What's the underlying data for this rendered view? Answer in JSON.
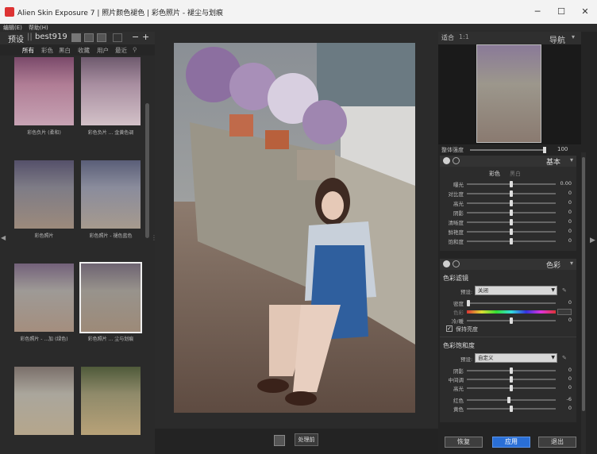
{
  "window": {
    "title": "Alien Skin Exposure 7 | 照片颜色褪色 | 彩色照片 - 褪尘与划痕",
    "minimize": "─",
    "maximize": "☐",
    "close": "✕"
  },
  "menu": [
    "编辑(E)",
    "帮助(H)"
  ],
  "presets": {
    "label": "预设",
    "separator": "||",
    "user": "best919",
    "plus": "+",
    "minus": "−",
    "categories": [
      "所有",
      "彩色",
      "黑白",
      "收藏",
      "用户",
      "最近"
    ],
    "thumbnails": [
      {
        "caption": "彩色负片 (柔和)"
      },
      {
        "caption": "彩色负片 ... 金黄色调"
      },
      {
        "caption": "彩色照片"
      },
      {
        "caption": "彩色照片 - 褪色蓝色"
      },
      {
        "caption": "彩色照片 - ...加 (绿色)"
      },
      {
        "caption": "彩色照片 ... 尘与划痕"
      },
      {
        "caption": ""
      },
      {
        "caption": ""
      }
    ]
  },
  "center": {
    "before_label": "处理前"
  },
  "navigator": {
    "fit_label": "适合",
    "ratio_label": "1:1",
    "title": "导航"
  },
  "overall_strength": {
    "label": "整体强度",
    "value": "100"
  },
  "basic": {
    "title": "基本",
    "tabs": [
      "彩色",
      "黑白"
    ],
    "sliders": [
      {
        "name": "曝光",
        "value": "0.00",
        "level": 0.5
      },
      {
        "name": "对比度",
        "value": "0",
        "level": 0.5
      },
      {
        "name": "高光",
        "value": "0",
        "level": 0.5
      },
      {
        "name": "阴影",
        "value": "0",
        "level": 0.5
      },
      {
        "name": "清晰度",
        "value": "0",
        "level": 0.5
      },
      {
        "name": "鲜艳度",
        "value": "0",
        "level": 0.5
      },
      {
        "name": "饱和度",
        "value": "0",
        "level": 0.5
      }
    ]
  },
  "color": {
    "title": "色彩",
    "filter_title": "色彩滤镜",
    "preset_label": "预设:",
    "filter_preset": "关闭",
    "density_label": "密度",
    "hue_label": "色彩",
    "temp_label": "冷/暖",
    "density_value": "0",
    "temp_value": "0",
    "preserve_label": "保持亮度",
    "preserve_checked": "✓",
    "saturation_title": "色彩饱和度",
    "sat_preset": "自定义",
    "sat_sliders": [
      {
        "name": "阴影",
        "value": "0",
        "level": 0.5
      },
      {
        "name": "中间调",
        "value": "0",
        "level": 0.5
      },
      {
        "name": "高光",
        "value": "0",
        "level": 0.5
      }
    ],
    "hue_sliders": [
      {
        "name": "红色",
        "value": "-6",
        "level": 0.47
      },
      {
        "name": "黄色",
        "value": "0",
        "level": 0.5
      }
    ]
  },
  "buttons": {
    "reset": "恢复",
    "apply": "应用",
    "exit": "退出"
  },
  "colors": {
    "accent": "#2a6fd6",
    "panel": "#2c2c2c"
  }
}
